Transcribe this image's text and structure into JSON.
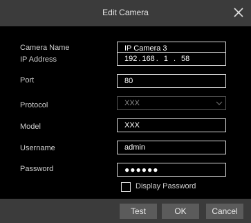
{
  "dialog": {
    "title": "Edit Camera"
  },
  "form": {
    "camera_name": {
      "label": "Camera Name",
      "value": "IP Camera 3"
    },
    "ip_address": {
      "label": "IP Address",
      "seg1": "192",
      "seg2": "168",
      "seg3": "1",
      "seg4": "58"
    },
    "port": {
      "label": "Port",
      "value": "80"
    },
    "protocol": {
      "label": "Protocol",
      "value": "XXX"
    },
    "model": {
      "label": "Model",
      "value": "XXX"
    },
    "username": {
      "label": "Username",
      "value": "admin"
    },
    "password": {
      "label": "Password",
      "value": "●●●●●●"
    },
    "display_password": {
      "label": "Display Password",
      "checked": false
    }
  },
  "buttons": {
    "test": "Test",
    "ok": "OK",
    "cancel": "Cancel"
  },
  "icons": {
    "close": "close-icon",
    "protocol_dropdown": "chevron-down-icon",
    "checkbox": "checkbox-icon"
  },
  "colors": {
    "background": "#000000",
    "bar": "#3b3b3b",
    "button": "#5b5b5b",
    "field_border": "#d8d8d8",
    "text": "#d0d0d0"
  }
}
